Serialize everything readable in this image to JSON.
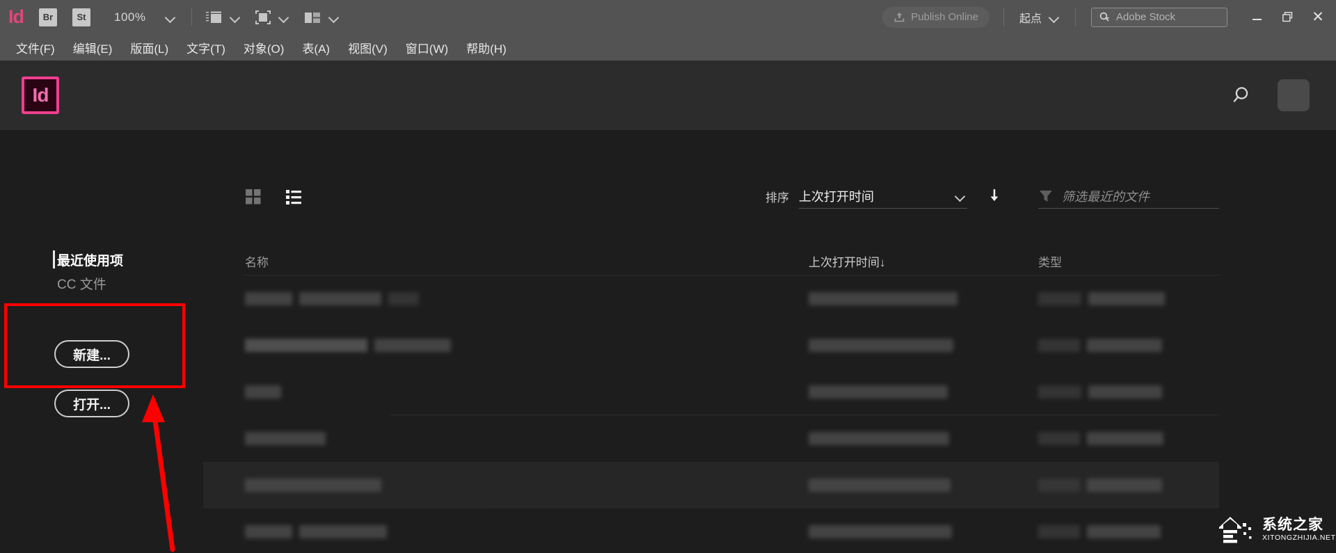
{
  "app": {
    "name": "Adobe InDesign",
    "logo_text": "Id"
  },
  "titlebar": {
    "bridge_label": "Br",
    "stock_label": "St",
    "zoom_level": "100%",
    "screen_mode_icon": "screen-mode-icon",
    "view_mode_icon": "view-mode-icon",
    "arrange_docs_icon": "arrange-documents-icon",
    "publish_label": "Publish Online",
    "publish_icon": "publish-upload-icon",
    "workspace_label": "起点",
    "stock_placeholder": "Adobe Stock",
    "stock_search_icon": "search-dropdown-icon",
    "window_minimize": "minimize-icon",
    "window_restore": "restore-icon",
    "window_close": "✕"
  },
  "menubar": {
    "items": [
      {
        "label": "文件(F)"
      },
      {
        "label": "编辑(E)"
      },
      {
        "label": "版面(L)"
      },
      {
        "label": "文字(T)"
      },
      {
        "label": "对象(O)"
      },
      {
        "label": "表(A)"
      },
      {
        "label": "视图(V)"
      },
      {
        "label": "窗口(W)"
      },
      {
        "label": "帮助(H)"
      }
    ]
  },
  "homebar": {
    "logo_text": "Id",
    "search_icon": "search-icon",
    "avatar": "user-avatar"
  },
  "toolbar": {
    "grid_view_icon": "grid-view-icon",
    "list_view_icon": "list-view-icon",
    "sort_label": "排序",
    "sort_value": "上次打开时间",
    "sort_chevron_icon": "chevron-down-icon",
    "sort_direction_icon": "sort-descending-arrow-icon",
    "filter_icon": "filter-funnel-icon",
    "filter_placeholder": "筛选最近的文件"
  },
  "sidebar": {
    "items": [
      {
        "label": "最近使用项",
        "active": true
      },
      {
        "label": "CC 文件",
        "active": false
      }
    ],
    "buttons": [
      {
        "label": "新建...",
        "name": "new-document-button"
      },
      {
        "label": "打开...",
        "name": "open-document-button"
      }
    ]
  },
  "table": {
    "columns": [
      {
        "label": "名称",
        "key": "name",
        "sorted": false
      },
      {
        "label": "上次打开时间",
        "key": "date",
        "sorted": true,
        "sort_arrow": "↓"
      },
      {
        "label": "类型",
        "key": "type",
        "sorted": false
      }
    ],
    "rows": [
      {
        "name_redacted": true,
        "date_redacted": true,
        "type_redacted": true,
        "selected": false
      },
      {
        "name_redacted": true,
        "date_redacted": true,
        "type_redacted": true,
        "selected": false
      },
      {
        "name_redacted": true,
        "date_redacted": true,
        "type_redacted": true,
        "selected": false
      },
      {
        "name_redacted": true,
        "date_redacted": true,
        "type_redacted": true,
        "selected": false
      },
      {
        "name_redacted": true,
        "date_redacted": true,
        "type_redacted": true,
        "selected": true
      },
      {
        "name_redacted": true,
        "date_redacted": true,
        "type_redacted": true,
        "selected": false
      }
    ],
    "note": "All file names, dates and types are blurred/redacted in the screenshot"
  },
  "annotations": {
    "highlight_box": {
      "color": "#fe0000",
      "target": "新建..."
    },
    "arrow": {
      "color": "#fe0000",
      "points_to": "新建... 按钮区域"
    }
  },
  "watermark": {
    "cn": "系统之家",
    "en": "XITONGZHIJIA.NET"
  },
  "colors": {
    "titlebar_bg": "#535353",
    "home_bg": "#2c2c2c",
    "content_bg": "#1d1d1d",
    "accent_pink": "#ef3f8f",
    "annotation_red": "#fe0000"
  }
}
